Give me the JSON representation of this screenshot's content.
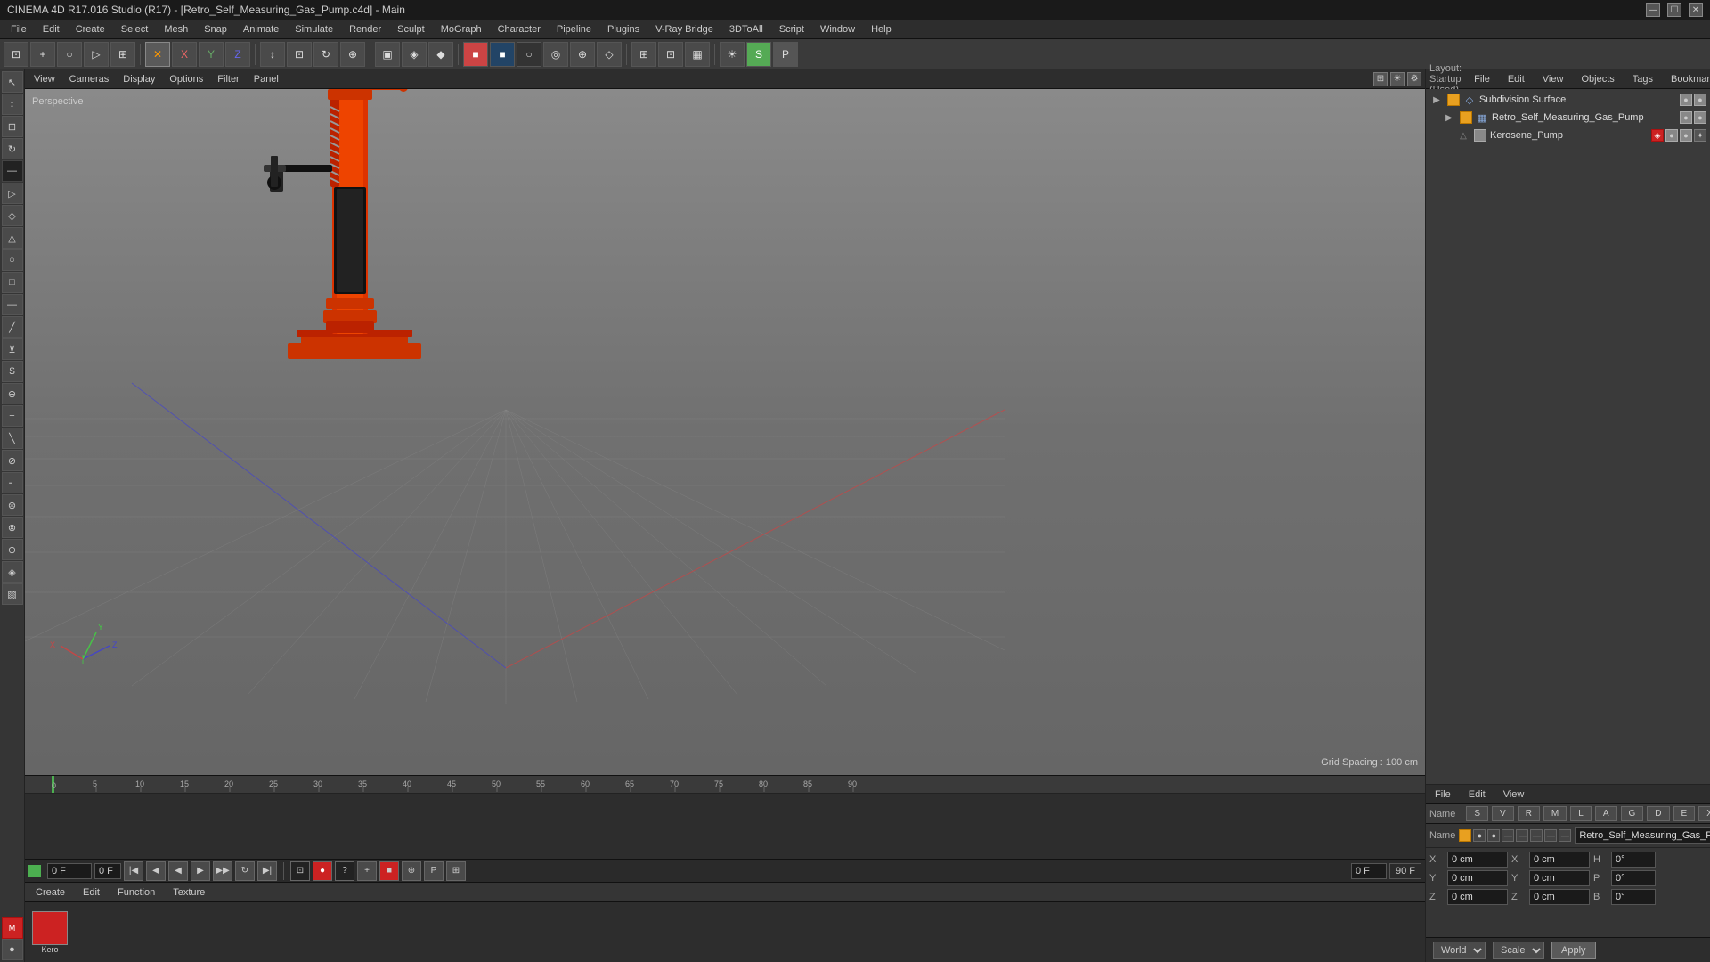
{
  "titlebar": {
    "title": "CINEMA 4D R17.016 Studio (R17) - [Retro_Self_Measuring_Gas_Pump.c4d] - Main",
    "controls": [
      "—",
      "☐",
      "✕"
    ]
  },
  "menubar": {
    "items": [
      "File",
      "Edit",
      "Create",
      "Select",
      "Mesh",
      "Snap",
      "Animate",
      "Simulate",
      "Render",
      "Sculpt",
      "MoGraph",
      "Character",
      "Pipeline",
      "Plugins",
      "V-Ray Bridge",
      "3DToAll",
      "Script",
      "Window",
      "Help"
    ]
  },
  "viewport": {
    "perspective_label": "Perspective",
    "grid_spacing_label": "Grid Spacing : 100 cm",
    "menus": [
      "View",
      "Cameras",
      "Display",
      "Options",
      "Filter",
      "Panel"
    ]
  },
  "object_manager": {
    "header_menus": [
      "File",
      "Edit",
      "View",
      "Objects",
      "Tags",
      "Bookmarks"
    ],
    "layout_label": "Layout: Startup (Used)",
    "objects": [
      {
        "name": "Subdivision Surface",
        "icon": "◇",
        "indent": 0,
        "color": "#e8a020",
        "has_children": true,
        "tags": []
      },
      {
        "name": "Retro_Self_Measuring_Gas_Pump",
        "icon": "▦",
        "indent": 1,
        "color": "#e8a020",
        "has_children": true,
        "tags": []
      },
      {
        "name": "Kerosene_Pump",
        "icon": "△",
        "indent": 2,
        "color": "#888",
        "has_children": false,
        "tags": [
          "◈",
          "✕",
          "✦"
        ]
      }
    ]
  },
  "attributes": {
    "header_menus": [
      "File",
      "Edit",
      "View"
    ],
    "name_label": "Name",
    "object_name": "Retro_Self_Measuring_Gas_Pump",
    "tabs": [
      "S",
      "V",
      "R",
      "M",
      "L",
      "A",
      "G",
      "D",
      "E",
      "X"
    ],
    "coords": [
      {
        "axis": "X",
        "pos_val": "0 cm",
        "pos_label": "X",
        "pos2_val": "0 cm",
        "extra_label": "H",
        "extra_val": "0°"
      },
      {
        "axis": "Y",
        "pos_val": "0 cm",
        "pos_label": "Y",
        "pos2_val": "0 cm",
        "extra_label": "P",
        "extra_val": "0°"
      },
      {
        "axis": "Z",
        "pos_val": "0 cm",
        "pos_label": "Z",
        "pos2_val": "0 cm",
        "extra_label": "B",
        "extra_val": "0°"
      }
    ],
    "world_label": "World",
    "scale_label": "Scale",
    "apply_label": "Apply"
  },
  "material_panel": {
    "menus": [
      "Create",
      "Edit",
      "Function",
      "Texture"
    ],
    "materials": [
      {
        "name": "Kero",
        "color": "#cc2222"
      }
    ]
  },
  "timeline": {
    "current_frame": "0 F",
    "end_frame": "90 F",
    "frame_display": "0 F",
    "frame_display2": "0 F",
    "tick_count": "1",
    "ticks": [
      0,
      5,
      10,
      15,
      20,
      25,
      30,
      35,
      40,
      45,
      50,
      55,
      60,
      65,
      70,
      75,
      80,
      85,
      90
    ]
  },
  "icons": {
    "move": "↕",
    "rotate": "↻",
    "scale": "⊡",
    "select": "↖",
    "play": "▶",
    "stop": "■",
    "rewind": "◀◀",
    "forward": "▶▶",
    "record": "●"
  }
}
